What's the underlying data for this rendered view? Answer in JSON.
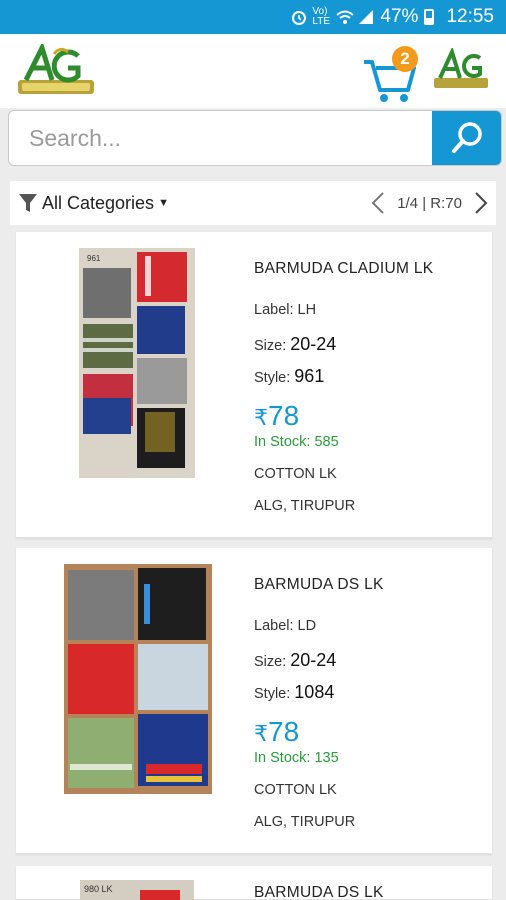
{
  "status_bar": {
    "battery": "47%",
    "time": "12:55",
    "network": "Vo) LTE"
  },
  "header": {
    "cart_count": "2",
    "accent_color": "#1597d3",
    "badge_color": "#f39a1b"
  },
  "search": {
    "placeholder": "Search...",
    "value": ""
  },
  "filter": {
    "category_label": "All Categories",
    "page_info": "1/4 | R:70"
  },
  "products": [
    {
      "image_label": "961",
      "name": "BARMUDA CLADIUM LK",
      "label_key": "Label:",
      "label_val": "LH",
      "size_key": "Size:",
      "size_val": "20-24",
      "style_key": "Style:",
      "style_val": "961",
      "currency": "₹",
      "price": "78",
      "stock": "In Stock: 585",
      "material": "COTTON LK",
      "location": "ALG, TIRUPUR"
    },
    {
      "image_label": "",
      "name": "BARMUDA DS LK",
      "label_key": "Label:",
      "label_val": "LD",
      "size_key": "Size:",
      "size_val": "20-24",
      "style_key": "Style:",
      "style_val": "1084",
      "currency": "₹",
      "price": "78",
      "stock": "In Stock: 135",
      "material": "COTTON LK",
      "location": "ALG, TIRUPUR"
    },
    {
      "image_label": "980 LK",
      "name": "BARMUDA DS LK"
    }
  ]
}
